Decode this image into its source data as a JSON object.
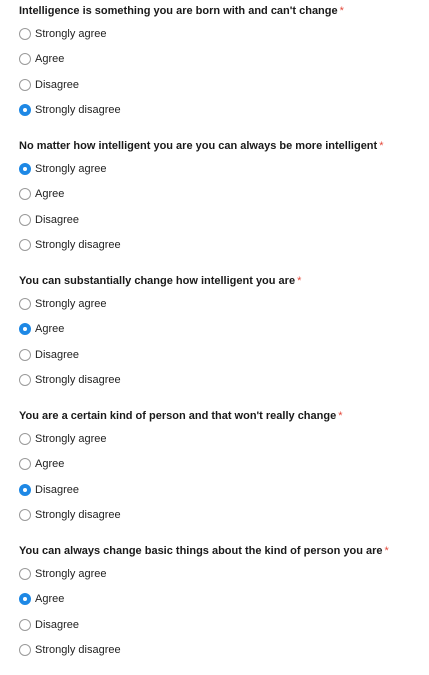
{
  "questions": [
    {
      "title": "Intelligence is something you are born with and can't change",
      "required_mark": "*",
      "options": [
        "Strongly agree",
        "Agree",
        "Disagree",
        "Strongly disagree"
      ],
      "selected": "Strongly disagree"
    },
    {
      "title": "No matter how intelligent you are you can always be more intelligent",
      "required_mark": "*",
      "options": [
        "Strongly agree",
        "Agree",
        "Disagree",
        "Strongly disagree"
      ],
      "selected": "Strongly agree"
    },
    {
      "title": "You can substantially change how intelligent you are",
      "required_mark": "*",
      "options": [
        "Strongly agree",
        "Agree",
        "Disagree",
        "Strongly disagree"
      ],
      "selected": "Agree"
    },
    {
      "title": "You are a certain kind of person and that won't really change",
      "required_mark": "*",
      "options": [
        "Strongly agree",
        "Agree",
        "Disagree",
        "Strongly disagree"
      ],
      "selected": "Disagree"
    },
    {
      "title": "You can always change basic things about the kind of person you are",
      "required_mark": "*",
      "options": [
        "Strongly agree",
        "Agree",
        "Disagree",
        "Strongly disagree"
      ],
      "selected": "Agree"
    }
  ],
  "colors": {
    "accent": "#1e88e5",
    "required": "#e4483a"
  }
}
